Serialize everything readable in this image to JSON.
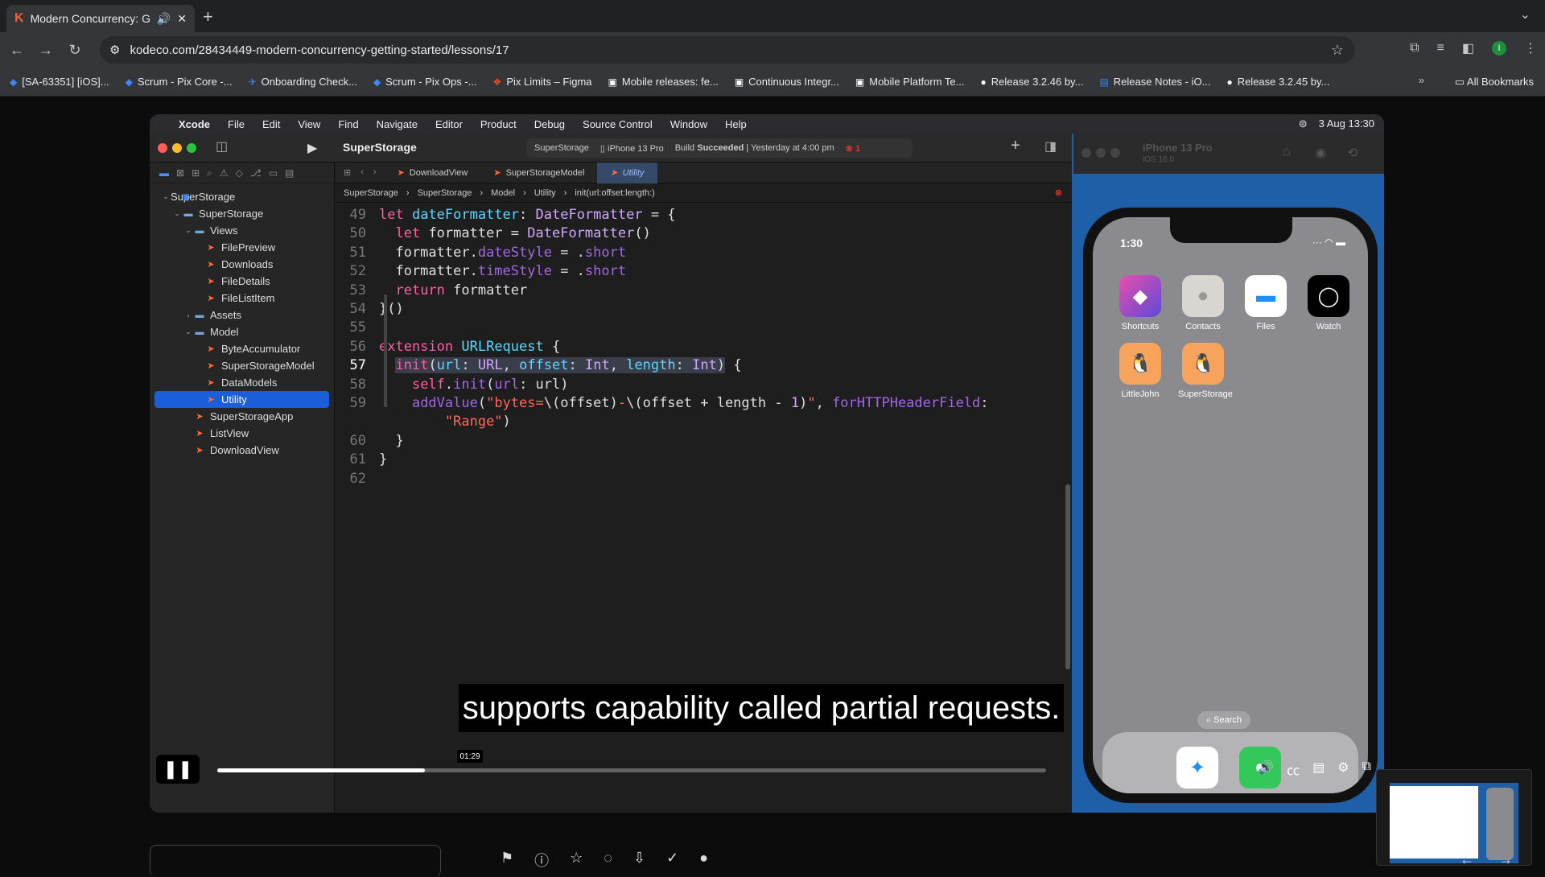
{
  "browser": {
    "tab_title": "Modern Concurrency: Get",
    "url": "kodeco.com/28434449-modern-concurrency-getting-started/lessons/17",
    "bookmarks": [
      "[SA-63351] [iOS]...",
      "Scrum - Pix Core -...",
      "Onboarding Check...",
      "Scrum - Pix Ops -...",
      "Pix Limits – Figma",
      "Mobile releases: fe...",
      "Continuous Integr...",
      "Mobile Platform Te...",
      "Release 3.2.46 by...",
      "Release Notes - iO...",
      "Release 3.2.45 by..."
    ],
    "all_bookmarks": "All Bookmarks",
    "avatar_letter": "I"
  },
  "mac_menu": {
    "items": [
      "Xcode",
      "File",
      "Edit",
      "View",
      "Find",
      "Navigate",
      "Editor",
      "Product",
      "Debug",
      "Source Control",
      "Window",
      "Help"
    ],
    "date_time": "3 Aug  13:30"
  },
  "xcode": {
    "project": "SuperStorage",
    "scheme": {
      "target": "SuperStorage",
      "device": "iPhone 13 Pro",
      "status_prefix": "Build",
      "status": "Succeeded",
      "status_time": "| Yesterday at 4:00 pm",
      "errors": "1"
    },
    "tree": [
      {
        "label": "SuperStorage",
        "indent": 0,
        "kind": "app",
        "arrow": "⌄"
      },
      {
        "label": "SuperStorage",
        "indent": 1,
        "kind": "fold",
        "arrow": "⌄"
      },
      {
        "label": "Views",
        "indent": 2,
        "kind": "fold",
        "arrow": "⌄"
      },
      {
        "label": "FilePreview",
        "indent": 3,
        "kind": "swift",
        "arrow": ""
      },
      {
        "label": "Downloads",
        "indent": 3,
        "kind": "swift",
        "arrow": ""
      },
      {
        "label": "FileDetails",
        "indent": 3,
        "kind": "swift",
        "arrow": ""
      },
      {
        "label": "FileListItem",
        "indent": 3,
        "kind": "swift",
        "arrow": ""
      },
      {
        "label": "Assets",
        "indent": 2,
        "kind": "fold",
        "arrow": "›"
      },
      {
        "label": "Model",
        "indent": 2,
        "kind": "fold",
        "arrow": "⌄"
      },
      {
        "label": "ByteAccumulator",
        "indent": 3,
        "kind": "swift",
        "arrow": ""
      },
      {
        "label": "SuperStorageModel",
        "indent": 3,
        "kind": "swift",
        "arrow": ""
      },
      {
        "label": "DataModels",
        "indent": 3,
        "kind": "swift",
        "arrow": ""
      },
      {
        "label": "Utility",
        "indent": 3,
        "kind": "swift",
        "arrow": "",
        "selected": true
      },
      {
        "label": "SuperStorageApp",
        "indent": 2,
        "kind": "swift",
        "arrow": ""
      },
      {
        "label": "ListView",
        "indent": 2,
        "kind": "swift",
        "arrow": ""
      },
      {
        "label": "DownloadView",
        "indent": 2,
        "kind": "swift",
        "arrow": ""
      }
    ],
    "tabs": [
      "DownloadView",
      "SuperStorageModel",
      "Utility"
    ],
    "breadcrumb": [
      "SuperStorage",
      "SuperStorage",
      "Model",
      "Utility",
      "init(url:offset:length:)"
    ]
  },
  "code_lines": [
    {
      "n": "49",
      "html": "<span class='kw'>let</span> <span class='bl'>dateFormatter</span>: <span class='ty'>DateFormatter</span> = {"
    },
    {
      "n": "50",
      "html": "  <span class='kw'>let</span> formatter = <span class='ty'>DateFormatter</span>()"
    },
    {
      "n": "51",
      "html": "  formatter.<span class='lab'>dateStyle</span> = .<span class='lab'>short</span>"
    },
    {
      "n": "52",
      "html": "  formatter.<span class='lab'>timeStyle</span> = .<span class='lab'>short</span>"
    },
    {
      "n": "53",
      "html": "  <span class='kw'>return</span> formatter"
    },
    {
      "n": "54",
      "html": "}()"
    },
    {
      "n": "55",
      "html": ""
    },
    {
      "n": "56",
      "html": "<span class='kw'>extension</span> <span class='bl'>URLRequest</span> {"
    },
    {
      "n": "57",
      "html": "  <span class='hl'><span class='kw'>init</span>(<span class='bl'>url</span>: <span class='ty'>URL</span>, <span class='bl'>offset</span>: <span class='ty'>Int</span>, <span class='bl'>length</span>: <span class='ty'>Int</span>)</span> {",
      "cur": true
    },
    {
      "n": "58",
      "html": "    <span class='kw'>self</span>.<span class='lab'>init</span>(<span class='lab'>url</span>: url)"
    },
    {
      "n": "59",
      "html": "    <span class='lab'>addValue</span>(<span class='str'>\"bytes=</span>\\(offset)<span class='str'>-</span>\\(offset + length - <span class='ty'>1</span>)<span class='str'>\"</span>, <span class='lab'>forHTTPHeaderField</span>:"
    },
    {
      "n": "",
      "html": "        <span class='str'>\"Range\"</span>)"
    },
    {
      "n": "60",
      "html": "  }"
    },
    {
      "n": "61",
      "html": "}"
    },
    {
      "n": "62",
      "html": ""
    }
  ],
  "simulator": {
    "device_name": "iPhone 13 Pro",
    "os": "iOS 16.0",
    "time": "1:30",
    "apps": [
      "Shortcuts",
      "Contacts",
      "Files",
      "Watch",
      "LittleJohn",
      "SuperStorage"
    ],
    "search_label": "Search"
  },
  "player": {
    "caption": "supports capability called partial requests.",
    "timestamp": "01:29",
    "progress": 0.25
  }
}
